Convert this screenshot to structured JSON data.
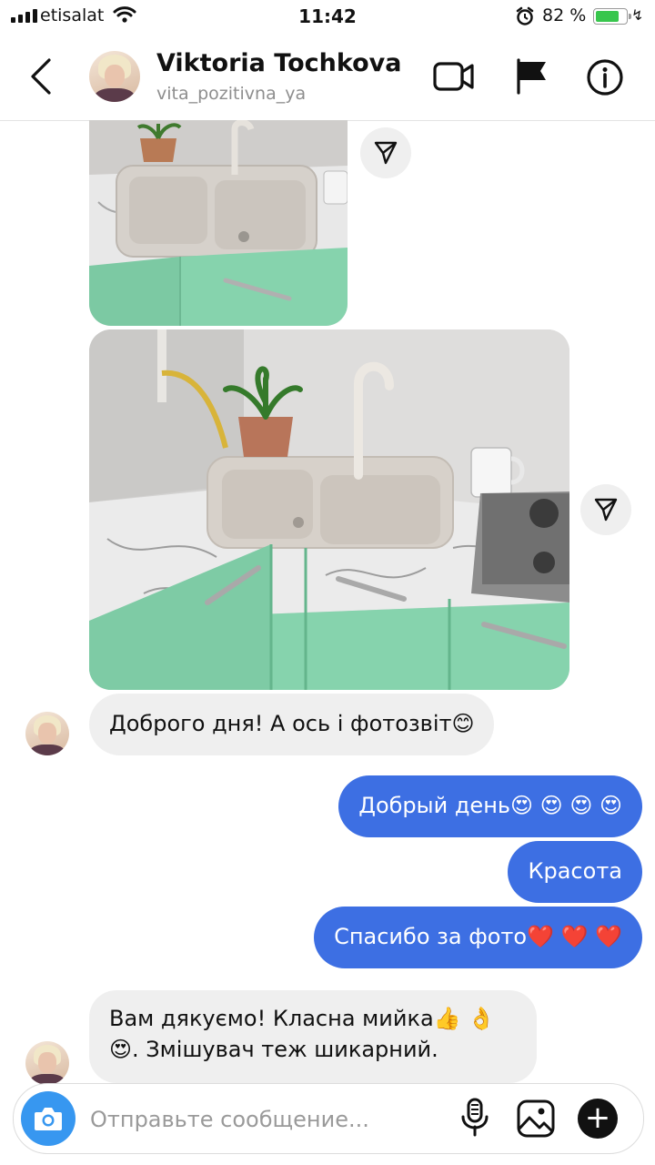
{
  "status_bar": {
    "carrier": "etisalat",
    "time": "11:42",
    "battery": "82 %",
    "battery_level": 0.82
  },
  "header": {
    "name": "Viktoria Tochkova",
    "username": "vita_pozitivna_ya"
  },
  "icons": {
    "back": "chevron-left-icon",
    "video_call": "video-camera-icon",
    "report": "flag-icon",
    "info": "info-icon",
    "share": "paper-plane-icon",
    "camera": "camera-icon",
    "mic": "microphone-icon",
    "gallery": "image-icon",
    "more": "plus-icon"
  },
  "messages": [
    {
      "side": "in",
      "text": "Доброго дня! А ось і фотозвіт😊"
    },
    {
      "side": "out",
      "text": "Добрый день😍 😍 😍 😍"
    },
    {
      "side": "out",
      "text": "Красота"
    },
    {
      "side": "out",
      "text": "Спасибо за фото❤️ ❤️ ❤️"
    },
    {
      "side": "in",
      "text": "Вам дякуємо! Класна мийка👍 👌😍. Змішувач теж шикарний."
    }
  ],
  "composer": {
    "placeholder": "Отправьте сообщение..."
  },
  "colors": {
    "outgoing_bubble": "#3d6fe3",
    "incoming_bubble": "#efefef",
    "camera_button": "#3797f0",
    "cabinet_green": "#86d3ad"
  }
}
